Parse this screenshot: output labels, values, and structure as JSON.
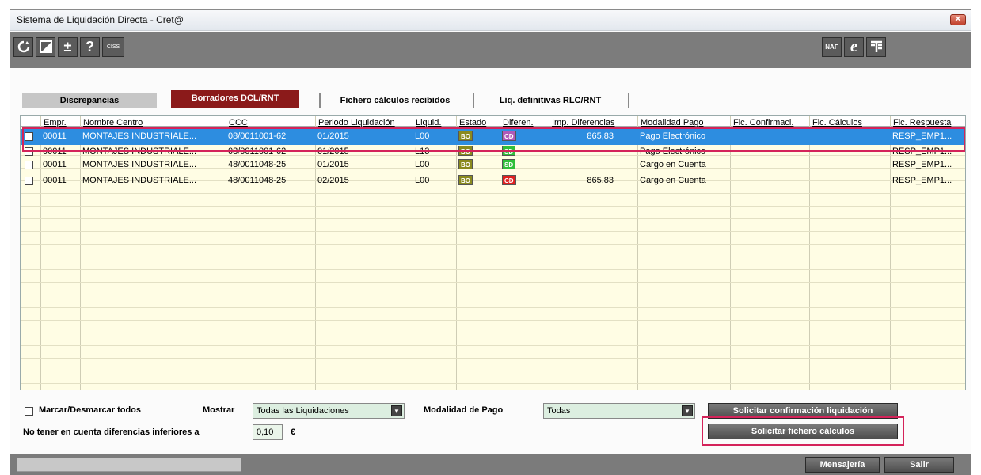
{
  "window": {
    "title": "Sistema de Liquidación Directa - Cret@",
    "close_label": "✕"
  },
  "toolbar": {
    "ciss_label": "CISS",
    "naf_label": "NAF",
    "plusminus_label": "±",
    "help_label": "?"
  },
  "tabs": [
    {
      "label": "Discrepancias"
    },
    {
      "label": "Borradores DCL/RNT"
    },
    {
      "label": "Fichero cálculos recibidos"
    },
    {
      "label": "Liq. definitivas RLC/RNT"
    }
  ],
  "table": {
    "columns": [
      "Empr.",
      "Nombre Centro",
      "CCC",
      "Periodo Liquidación",
      "Liquid.",
      "Estado",
      "Diferen.",
      "Imp. Diferencias",
      "Modalidad Pago",
      "Fic. Confirmaci.",
      "Fic. Cálculos",
      "Fic. Respuesta"
    ],
    "rows": [
      {
        "empr": "00011",
        "nombre": "MONTAJES INDUSTRIALE...",
        "ccc": "08/0011001-62",
        "periodo": "01/2015",
        "liquid": "L00",
        "estado": "BO",
        "diferen": "CD",
        "imp": "865,83",
        "modalidad": "Pago Electrónico",
        "fic_conf": "",
        "fic_calc": "",
        "fic_resp": "RESP_EMP1..."
      },
      {
        "empr": "00011",
        "nombre": "MONTAJES INDUSTRIALE...",
        "ccc": "08/0011001-62",
        "periodo": "01/2015",
        "liquid": "L13",
        "estado": "BO",
        "diferen": "SD",
        "imp": "",
        "modalidad": "Pago Electrónico",
        "fic_conf": "",
        "fic_calc": "",
        "fic_resp": "RESP_EMP1..."
      },
      {
        "empr": "00011",
        "nombre": "MONTAJES INDUSTRIALE...",
        "ccc": "48/0011048-25",
        "periodo": "01/2015",
        "liquid": "L00",
        "estado": "BO",
        "diferen": "SD",
        "imp": "",
        "modalidad": "Cargo en Cuenta",
        "fic_conf": "",
        "fic_calc": "",
        "fic_resp": "RESP_EMP1..."
      },
      {
        "empr": "00011",
        "nombre": "MONTAJES INDUSTRIALE...",
        "ccc": "48/0011048-25",
        "periodo": "02/2015",
        "liquid": "L00",
        "estado": "BO",
        "diferen": "CD",
        "imp": "865,83",
        "modalidad": "Cargo en Cuenta",
        "fic_conf": "",
        "fic_calc": "",
        "fic_resp": "RESP_EMP1..."
      }
    ]
  },
  "footer": {
    "toggle_all_label": "Marcar/Desmarcar todos",
    "mostrar_label": "Mostrar",
    "mostrar_value": "Todas las Liquidaciones",
    "modalidad_label": "Modalidad de Pago",
    "modalidad_value": "Todas",
    "threshold_label": "No tener en cuenta diferencias inferiores a",
    "threshold_value": "0,10",
    "currency": "€",
    "btn_confirm": "Solicitar confirmación liquidación",
    "btn_calc": "Solicitar fichero cálculos"
  },
  "status": {
    "mensajeria": "Mensajería",
    "salir": "Salir"
  },
  "colors": {
    "selected_row": "#2d8de0",
    "badge_bo": "#8a8a1e",
    "badge_sd": "#2fbf3a",
    "badge_cd_red": "#e02020",
    "badge_cd_purple": "#b05ab8",
    "highlight": "#d4235a",
    "active_tab": "#8b1a1a"
  }
}
